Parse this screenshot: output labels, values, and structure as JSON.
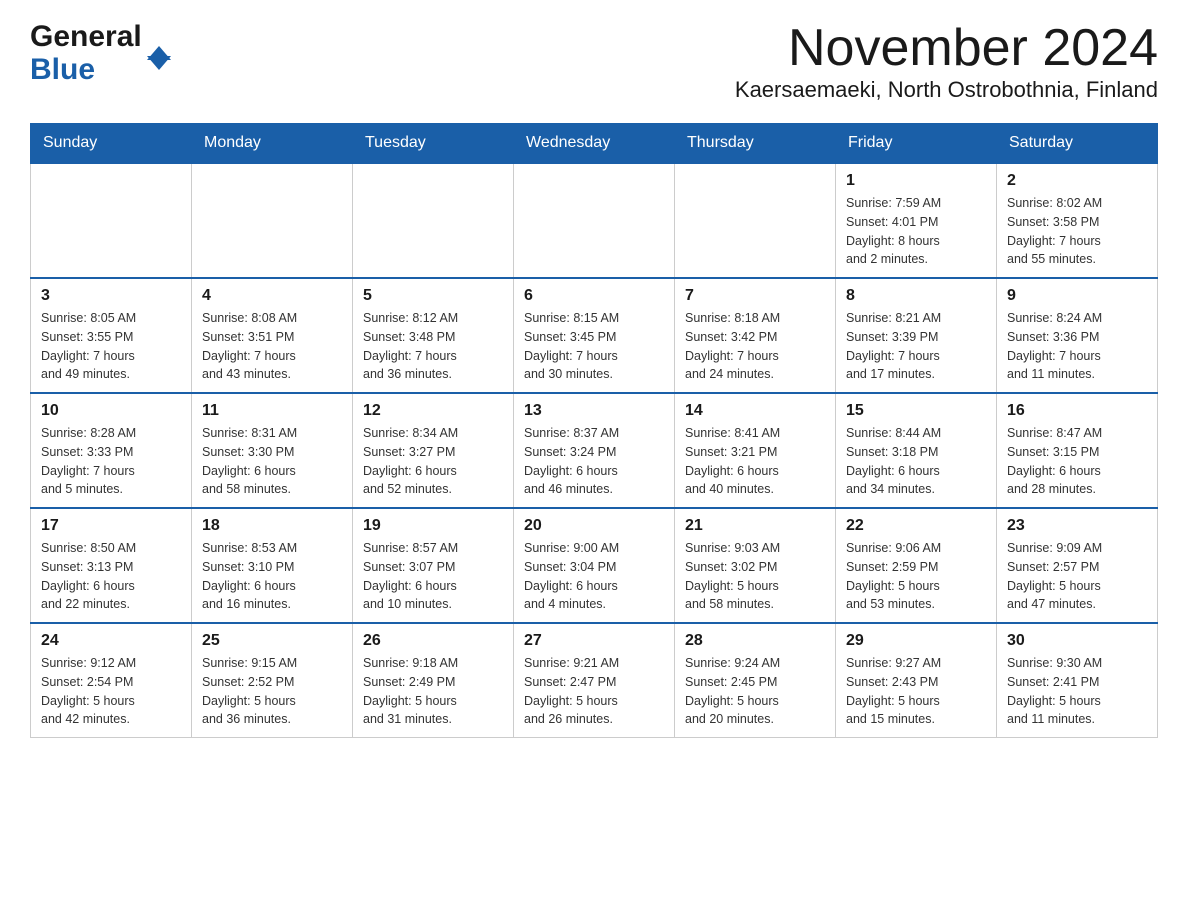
{
  "header": {
    "logo_general": "General",
    "logo_blue": "Blue",
    "title": "November 2024",
    "subtitle": "Kaersaemaeki, North Ostrobothnia, Finland"
  },
  "calendar": {
    "days_of_week": [
      "Sunday",
      "Monday",
      "Tuesday",
      "Wednesday",
      "Thursday",
      "Friday",
      "Saturday"
    ],
    "weeks": [
      [
        {
          "day": "",
          "info": ""
        },
        {
          "day": "",
          "info": ""
        },
        {
          "day": "",
          "info": ""
        },
        {
          "day": "",
          "info": ""
        },
        {
          "day": "",
          "info": ""
        },
        {
          "day": "1",
          "info": "Sunrise: 7:59 AM\nSunset: 4:01 PM\nDaylight: 8 hours\nand 2 minutes."
        },
        {
          "day": "2",
          "info": "Sunrise: 8:02 AM\nSunset: 3:58 PM\nDaylight: 7 hours\nand 55 minutes."
        }
      ],
      [
        {
          "day": "3",
          "info": "Sunrise: 8:05 AM\nSunset: 3:55 PM\nDaylight: 7 hours\nand 49 minutes."
        },
        {
          "day": "4",
          "info": "Sunrise: 8:08 AM\nSunset: 3:51 PM\nDaylight: 7 hours\nand 43 minutes."
        },
        {
          "day": "5",
          "info": "Sunrise: 8:12 AM\nSunset: 3:48 PM\nDaylight: 7 hours\nand 36 minutes."
        },
        {
          "day": "6",
          "info": "Sunrise: 8:15 AM\nSunset: 3:45 PM\nDaylight: 7 hours\nand 30 minutes."
        },
        {
          "day": "7",
          "info": "Sunrise: 8:18 AM\nSunset: 3:42 PM\nDaylight: 7 hours\nand 24 minutes."
        },
        {
          "day": "8",
          "info": "Sunrise: 8:21 AM\nSunset: 3:39 PM\nDaylight: 7 hours\nand 17 minutes."
        },
        {
          "day": "9",
          "info": "Sunrise: 8:24 AM\nSunset: 3:36 PM\nDaylight: 7 hours\nand 11 minutes."
        }
      ],
      [
        {
          "day": "10",
          "info": "Sunrise: 8:28 AM\nSunset: 3:33 PM\nDaylight: 7 hours\nand 5 minutes."
        },
        {
          "day": "11",
          "info": "Sunrise: 8:31 AM\nSunset: 3:30 PM\nDaylight: 6 hours\nand 58 minutes."
        },
        {
          "day": "12",
          "info": "Sunrise: 8:34 AM\nSunset: 3:27 PM\nDaylight: 6 hours\nand 52 minutes."
        },
        {
          "day": "13",
          "info": "Sunrise: 8:37 AM\nSunset: 3:24 PM\nDaylight: 6 hours\nand 46 minutes."
        },
        {
          "day": "14",
          "info": "Sunrise: 8:41 AM\nSunset: 3:21 PM\nDaylight: 6 hours\nand 40 minutes."
        },
        {
          "day": "15",
          "info": "Sunrise: 8:44 AM\nSunset: 3:18 PM\nDaylight: 6 hours\nand 34 minutes."
        },
        {
          "day": "16",
          "info": "Sunrise: 8:47 AM\nSunset: 3:15 PM\nDaylight: 6 hours\nand 28 minutes."
        }
      ],
      [
        {
          "day": "17",
          "info": "Sunrise: 8:50 AM\nSunset: 3:13 PM\nDaylight: 6 hours\nand 22 minutes."
        },
        {
          "day": "18",
          "info": "Sunrise: 8:53 AM\nSunset: 3:10 PM\nDaylight: 6 hours\nand 16 minutes."
        },
        {
          "day": "19",
          "info": "Sunrise: 8:57 AM\nSunset: 3:07 PM\nDaylight: 6 hours\nand 10 minutes."
        },
        {
          "day": "20",
          "info": "Sunrise: 9:00 AM\nSunset: 3:04 PM\nDaylight: 6 hours\nand 4 minutes."
        },
        {
          "day": "21",
          "info": "Sunrise: 9:03 AM\nSunset: 3:02 PM\nDaylight: 5 hours\nand 58 minutes."
        },
        {
          "day": "22",
          "info": "Sunrise: 9:06 AM\nSunset: 2:59 PM\nDaylight: 5 hours\nand 53 minutes."
        },
        {
          "day": "23",
          "info": "Sunrise: 9:09 AM\nSunset: 2:57 PM\nDaylight: 5 hours\nand 47 minutes."
        }
      ],
      [
        {
          "day": "24",
          "info": "Sunrise: 9:12 AM\nSunset: 2:54 PM\nDaylight: 5 hours\nand 42 minutes."
        },
        {
          "day": "25",
          "info": "Sunrise: 9:15 AM\nSunset: 2:52 PM\nDaylight: 5 hours\nand 36 minutes."
        },
        {
          "day": "26",
          "info": "Sunrise: 9:18 AM\nSunset: 2:49 PM\nDaylight: 5 hours\nand 31 minutes."
        },
        {
          "day": "27",
          "info": "Sunrise: 9:21 AM\nSunset: 2:47 PM\nDaylight: 5 hours\nand 26 minutes."
        },
        {
          "day": "28",
          "info": "Sunrise: 9:24 AM\nSunset: 2:45 PM\nDaylight: 5 hours\nand 20 minutes."
        },
        {
          "day": "29",
          "info": "Sunrise: 9:27 AM\nSunset: 2:43 PM\nDaylight: 5 hours\nand 15 minutes."
        },
        {
          "day": "30",
          "info": "Sunrise: 9:30 AM\nSunset: 2:41 PM\nDaylight: 5 hours\nand 11 minutes."
        }
      ]
    ]
  }
}
